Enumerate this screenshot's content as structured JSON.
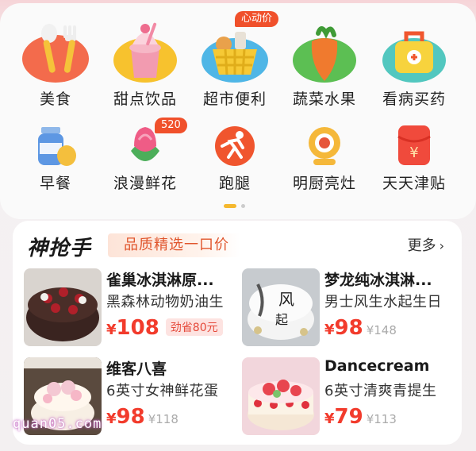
{
  "categories_row1": [
    {
      "icon": "utensils-icon",
      "label": "美食"
    },
    {
      "icon": "ice-cream-cup-icon",
      "label": "甜点饮品"
    },
    {
      "icon": "shopping-basket-icon",
      "label": "超市便利",
      "badge": "心动价"
    },
    {
      "icon": "carrot-icon",
      "label": "蔬菜水果"
    },
    {
      "icon": "medicine-box-icon",
      "label": "看病买药"
    }
  ],
  "categories_row2": [
    {
      "icon": "milk-bottle-egg-icon",
      "label": "早餐"
    },
    {
      "icon": "flower-bud-icon",
      "label": "浪漫鲜花",
      "badge": "520"
    },
    {
      "icon": "runner-icon",
      "label": "跑腿"
    },
    {
      "icon": "chef-camera-icon",
      "label": "明厨亮灶"
    },
    {
      "icon": "red-packet-icon",
      "label": "天天津贴"
    }
  ],
  "deals": {
    "brand": "神抢手",
    "slogan": "品质精选一口价",
    "more_label": "更多",
    "products": [
      {
        "name": "雀巢冰淇淋原...",
        "desc": "黑森林动物奶油生",
        "currency": "¥",
        "price": "108",
        "save_tag": "劲省80元",
        "thumb": "black-forest-cake-image"
      },
      {
        "name": "梦龙纯冰淇淋...",
        "desc": "男士风生水起生日",
        "currency": "¥",
        "price": "98",
        "original": "¥148",
        "thumb": "calligraphy-cake-image"
      },
      {
        "name": "维客八喜",
        "desc": "6英寸女神鲜花蛋",
        "currency": "¥",
        "price": "98",
        "original": "¥118",
        "thumb": "flower-cake-image"
      },
      {
        "name": "Dancecream",
        "desc": "6英寸清爽青提生",
        "currency": "¥",
        "price": "79",
        "original": "¥113",
        "thumb": "strawberry-cake-image"
      }
    ]
  },
  "watermark": "quan05.com",
  "colors": {
    "accent_red": "#f23b2c",
    "badge_orange": "#f0502b",
    "dot_active": "#f5b82e"
  }
}
